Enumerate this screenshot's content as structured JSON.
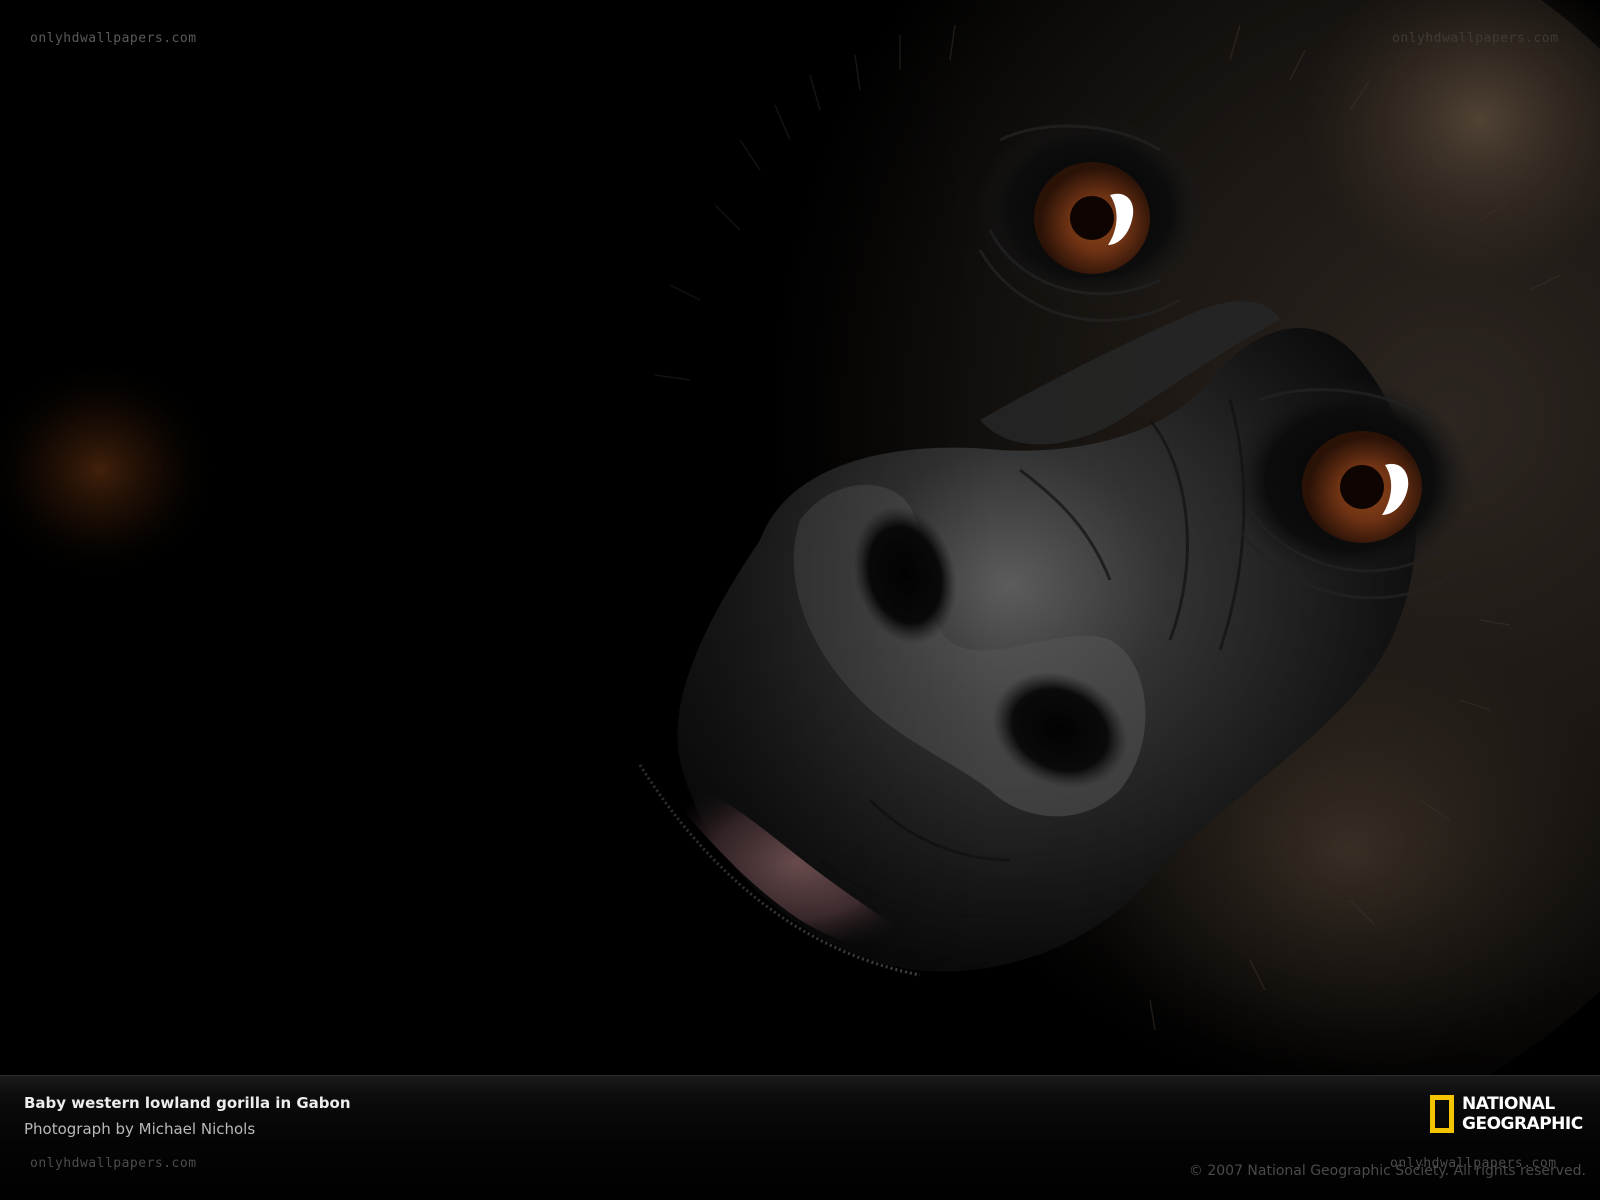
{
  "image": {
    "description_colors": {
      "background": "#000000",
      "fur_dark": "#1a1612",
      "fur_warm": "#4a3d30",
      "skin": "#2c2c2c",
      "iris": "#6e3214",
      "highlight": "#ffffff",
      "ambient_orange": "#b55a1e"
    }
  },
  "watermark": {
    "text": "onlyhdwallpapers.com"
  },
  "caption": {
    "title": "Baby western lowland gorilla in Gabon",
    "credit": "Photograph by Michael Nichols"
  },
  "logo": {
    "line1": "NATIONAL",
    "line2": "GEOGRAPHIC",
    "frame_color": "#f5c400"
  },
  "copyright": "© 2007 National Geographic Society. All rights reserved."
}
